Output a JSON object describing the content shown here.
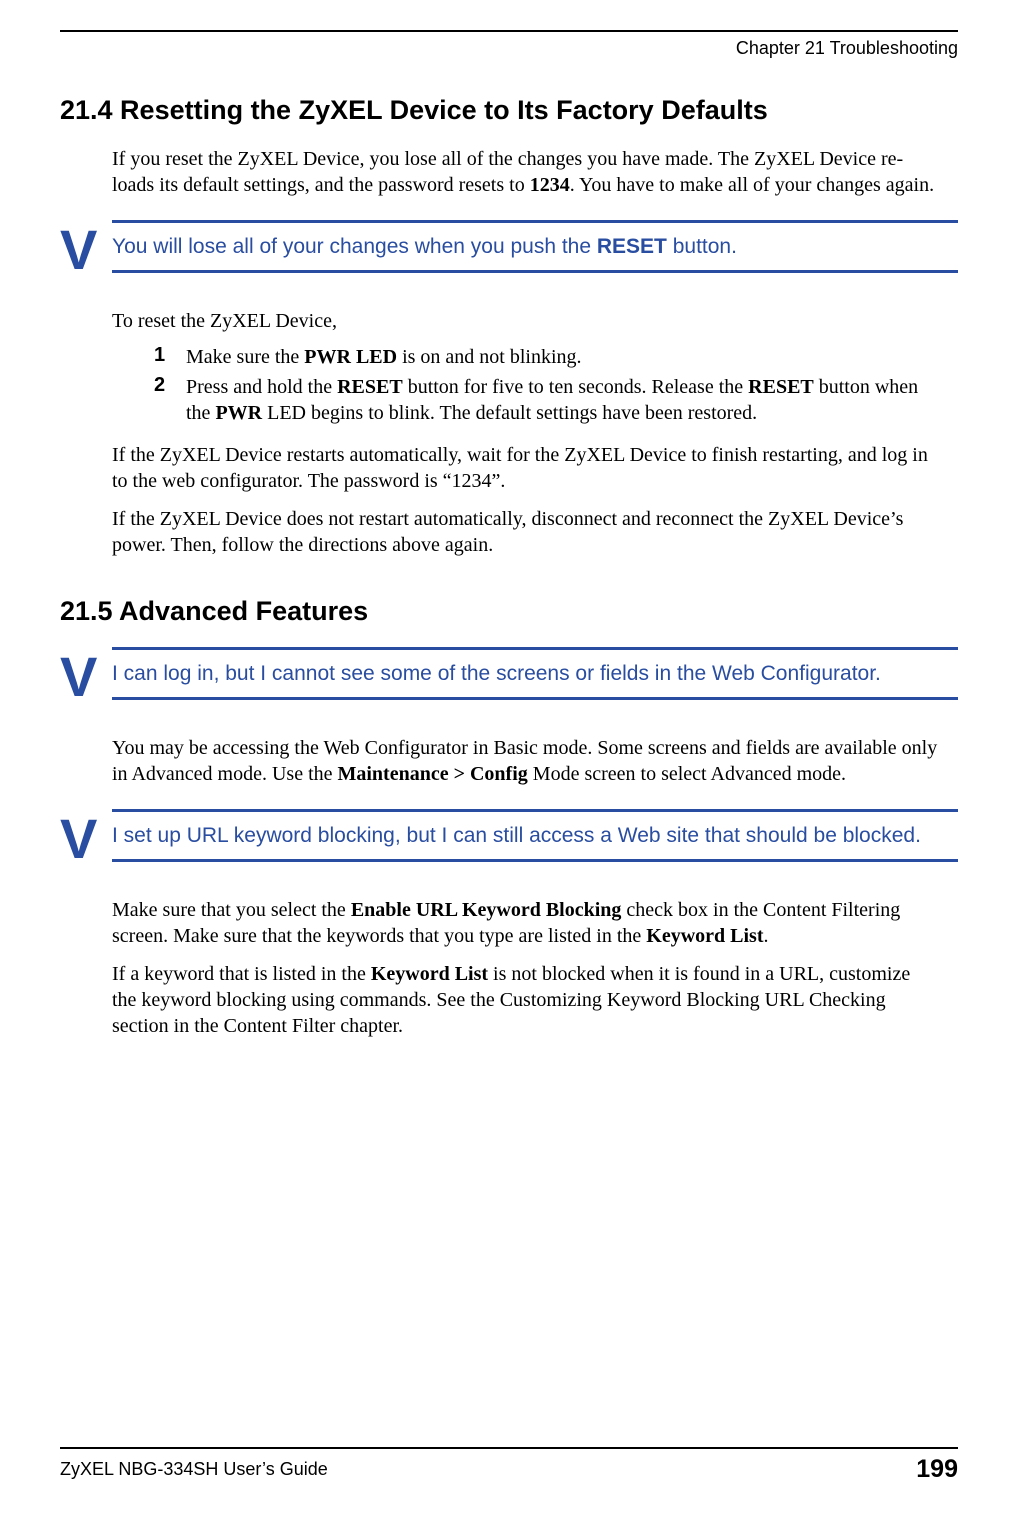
{
  "header": {
    "chapter": "Chapter 21 Troubleshooting"
  },
  "section214": {
    "heading": "21.4  Resetting the ZyXEL Device to Its Factory Defaults",
    "para1_a": "If you reset the ZyXEL Device, you lose all of the changes you have made. The ZyXEL Device re-loads its default settings, and the password resets to ",
    "para1_bold": "1234",
    "para1_b": ". You have to make all of your changes again.",
    "callout1_a": "You will lose all of your changes when you push the ",
    "callout1_bold": "RESET",
    "callout1_b": " button.",
    "para2": "To reset the ZyXEL Device,",
    "steps": [
      {
        "num": "1",
        "a": "Make sure the ",
        "b1": "PWR LED",
        "b": " is on and not blinking."
      },
      {
        "num": "2",
        "a": "Press and hold the ",
        "b1": "RESET",
        "b": " button for five to ten seconds. Release the ",
        "b2": "RESET",
        "c": " button when the ",
        "b3": "PWR",
        "d": " LED begins to blink. The default settings have been restored."
      }
    ],
    "para3": "If the ZyXEL Device restarts automatically, wait for the ZyXEL Device to finish restarting, and log in to the web configurator. The password is “1234”.",
    "para4": "If the ZyXEL Device does not restart automatically, disconnect and reconnect the ZyXEL Device’s power. Then, follow the directions above again."
  },
  "section215": {
    "heading": "21.5  Advanced Features",
    "callout1": "I can log in, but I cannot see some of the screens or fields in the Web Configurator.",
    "para1_a": "You may be accessing the Web Configurator in Basic mode. Some screens and fields are available only in Advanced mode. Use the ",
    "para1_bold": "Maintenance > Config",
    "para1_b": " Mode screen to select Advanced mode.",
    "callout2": "I set up URL keyword blocking, but I can still access a Web site that should be blocked.",
    "para2_a": "Make sure that you select the ",
    "para2_b1": "Enable URL Keyword Blocking",
    "para2_b": " check box in the Content Filtering screen. Make sure that the keywords that you type are listed in the ",
    "para2_b2": "Keyword List",
    "para2_c": ".",
    "para3_a": "If a keyword that is listed in the ",
    "para3_b1": "Keyword List",
    "para3_b": " is not blocked when it is found in a URL, customize the keyword blocking using commands. See the Customizing Keyword Blocking URL Checking section in the Content Filter chapter."
  },
  "footer": {
    "left": "ZyXEL NBG-334SH User’s Guide",
    "right": "199"
  },
  "icon": {
    "question": "V"
  }
}
